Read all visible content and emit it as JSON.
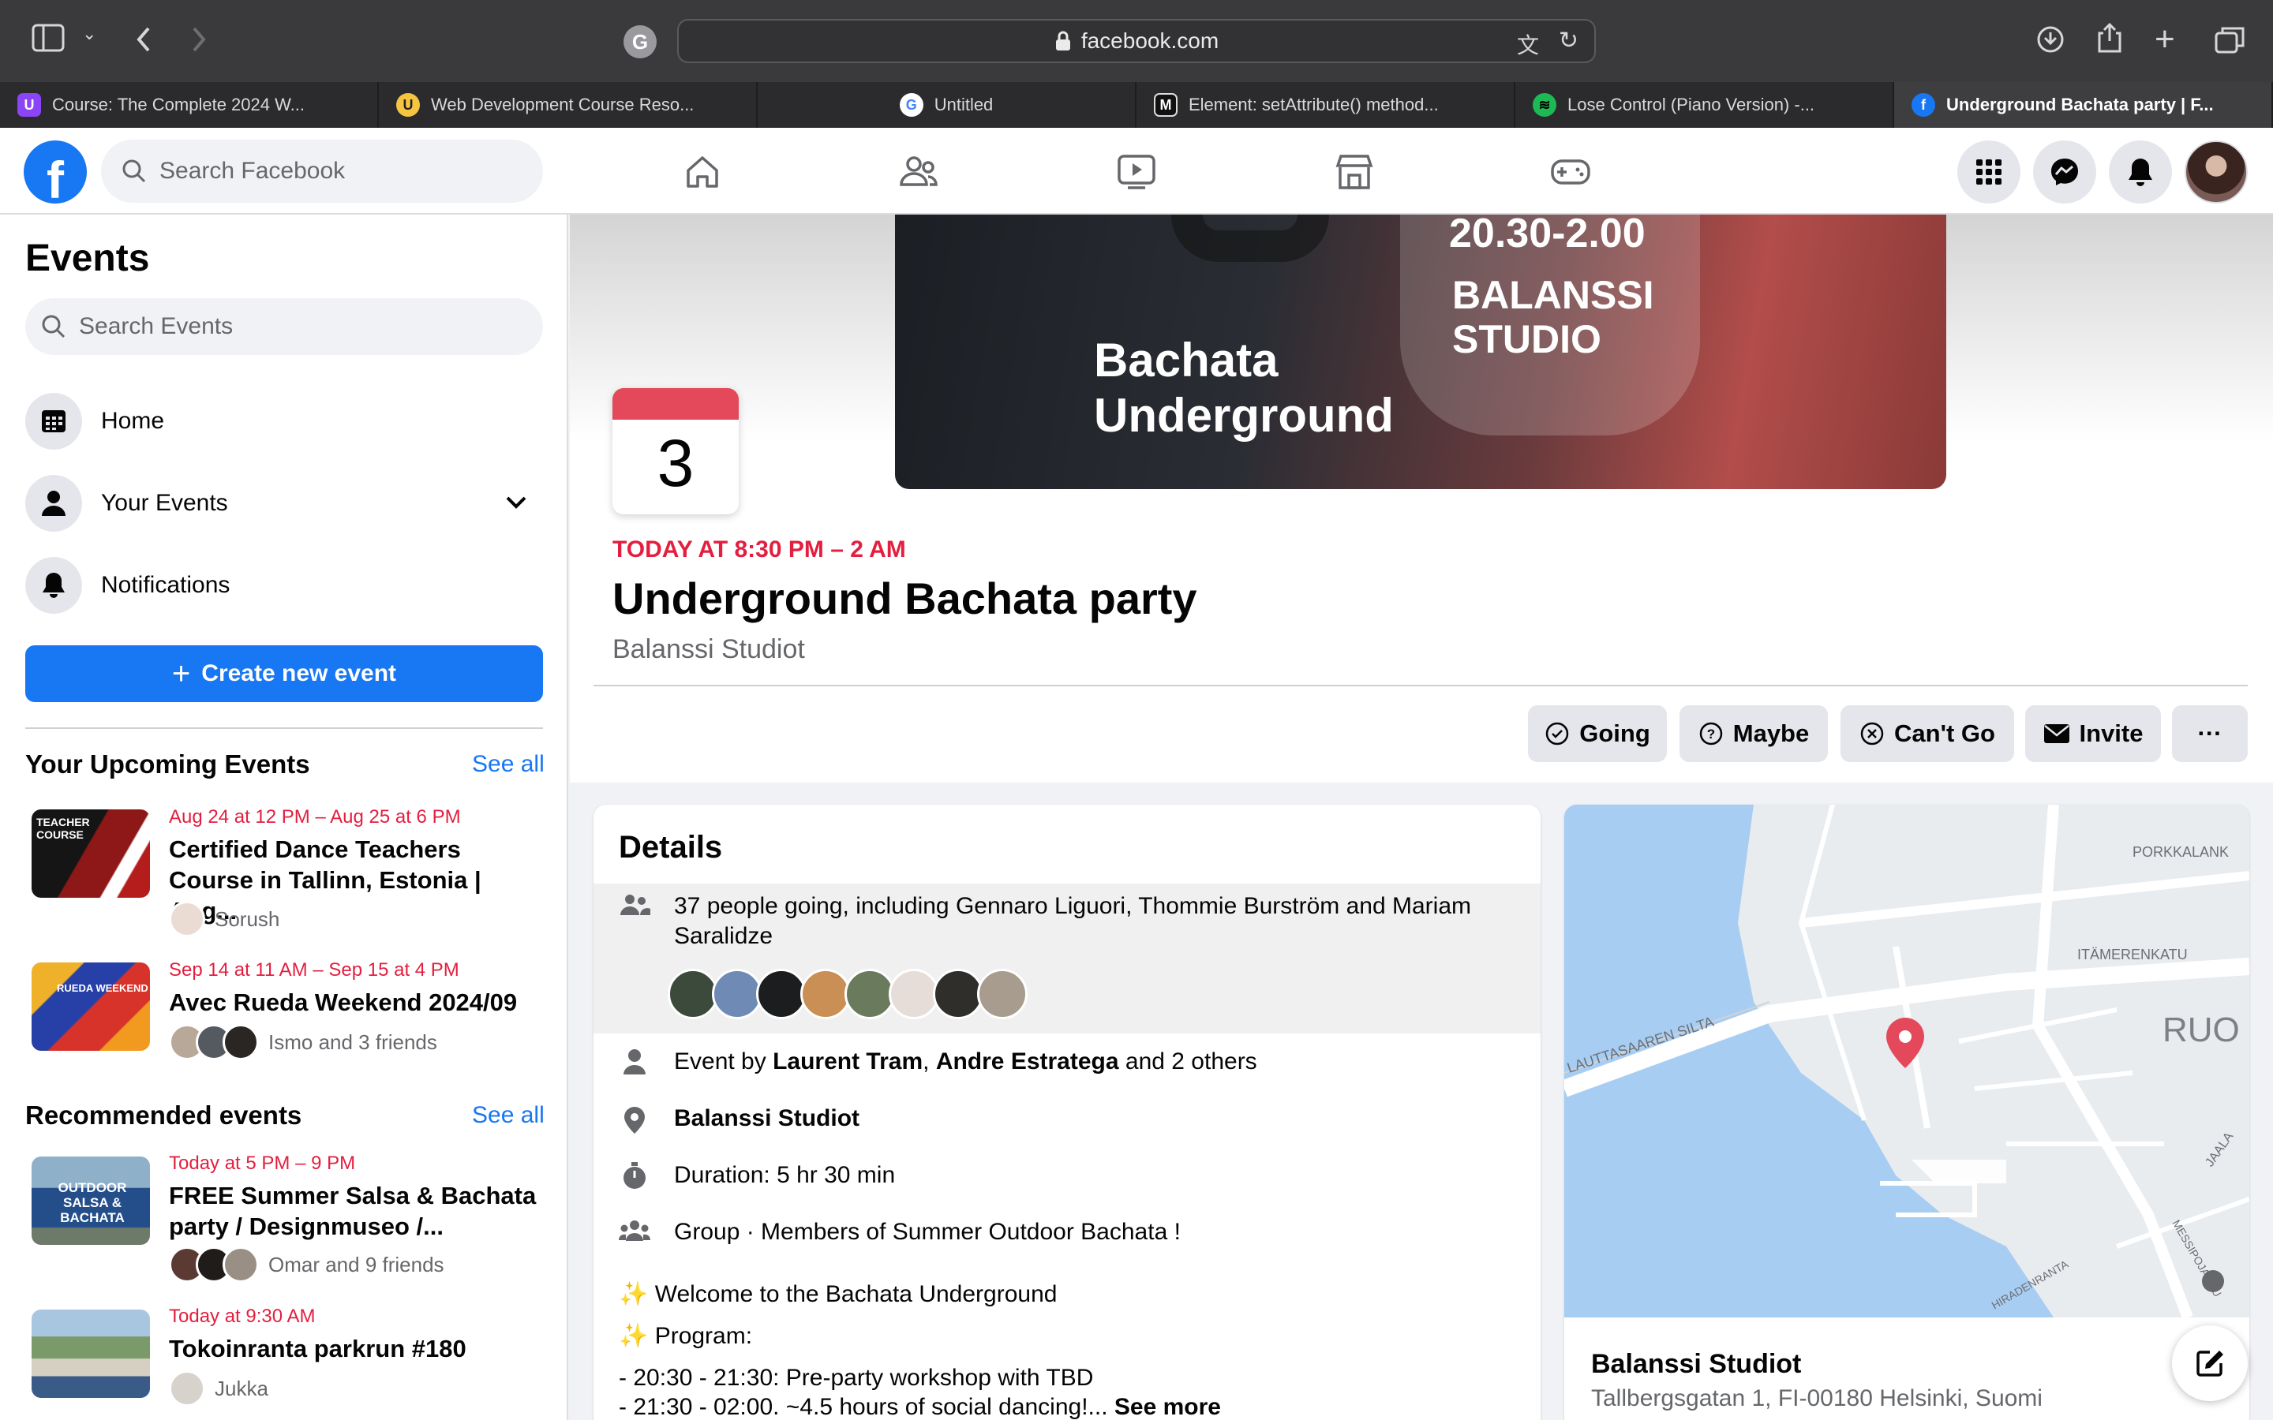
{
  "browser": {
    "url": "facebook.com",
    "tabs": [
      {
        "label": "Course: The Complete 2024 W...",
        "color": "#8c44f7",
        "glyph": "U"
      },
      {
        "label": "Web Development Course Reso...",
        "color": "#f5c542",
        "glyph": "U"
      },
      {
        "label": "Untitled",
        "color": "#ffffff",
        "glyph": "G"
      },
      {
        "label": "Element: setAttribute() method...",
        "color": "#111111",
        "glyph": "M"
      },
      {
        "label": "Lose Control (Piano Version) -...",
        "color": "#1db954",
        "glyph": "≋"
      },
      {
        "label": "Underground Bachata party | F...",
        "color": "#1877f2",
        "glyph": "f"
      }
    ]
  },
  "header": {
    "logo": "f",
    "search_placeholder": "Search Facebook"
  },
  "sidebar": {
    "title": "Events",
    "search_placeholder": "Search Events",
    "items": [
      {
        "label": "Home"
      },
      {
        "label": "Your Events"
      },
      {
        "label": "Notifications"
      }
    ],
    "create_label": "Create new event",
    "upcoming": {
      "title": "Your Upcoming Events",
      "see_all": "See all",
      "events": [
        {
          "date": "Aug 24 at 12 PM – Aug 25 at 6 PM",
          "title": "Certified Dance Teachers Course in Tallinn, Estonia | Aug...",
          "friends": "Sorush",
          "thumb_text": "TEACHER COURSE"
        },
        {
          "date": "Sep 14 at 11 AM – Sep 15 at 4 PM",
          "title": "Avec Rueda Weekend 2024/09",
          "friends": "Ismo and 3 friends",
          "thumb_text": "RUEDA WEEKEND"
        }
      ]
    },
    "recommended": {
      "title": "Recommended events",
      "see_all": "See all",
      "events": [
        {
          "date": "Today at 5 PM – 9 PM",
          "title": "FREE Summer Salsa & Bachata party / Designmuseo /...",
          "friends": "Omar and 9 friends",
          "thumb_text": "OUTDOOR SALSA & BACHATA"
        },
        {
          "date": "Today at 9:30 AM",
          "title": "Tokoinranta parkrun #180",
          "friends": "Jukka",
          "thumb_text": ""
        }
      ]
    }
  },
  "event": {
    "cover_time": "20.30-2.00",
    "cover_venue_1": "BALANSSI",
    "cover_venue_2": "STUDIO",
    "cover_title_1": "Bachata",
    "cover_title_2": "Underground",
    "day": "3",
    "when": "TODAY AT 8:30 PM – 2 AM",
    "name": "Underground Bachata party",
    "place": "Balanssi Studiot",
    "actions": {
      "going": "Going",
      "maybe": "Maybe",
      "cant_go": "Can't Go",
      "invite": "Invite",
      "more": "···"
    }
  },
  "details": {
    "title": "Details",
    "going_text": "37 people going, including Gennaro Liguori, Thommie Burström and Mariam Saralidze",
    "host_prefix": "Event by ",
    "host_1": "Laurent Tram",
    "host_sep": ", ",
    "host_2": "Andre Estratega",
    "host_suffix": " and 2 others",
    "location": "Balanssi Studiot",
    "duration": "Duration: 5 hr 30 min",
    "group": "Group · Members of Summer Outdoor Bachata !",
    "desc_1": "✨ Welcome to the Bachata Underground",
    "desc_2": "✨ Program:",
    "desc_3": "- 20:30 - 21:30: Pre-party workshop with TBD",
    "desc_4": "- 21:30 - 02:00. ~4.5 hours of social dancing!...",
    "see_more": "See more"
  },
  "map": {
    "labels": {
      "porkkalank": "PORKKALANK",
      "itamerenkatu": "ITÄMERENKATU",
      "silta": "LAUTTASAAREN SILTA",
      "ruo": "RUO",
      "jaala": "JAALA",
      "messipojan": "MESSIPOJANKU",
      "laadenranta": "HIRADENRANTA"
    },
    "place": "Balanssi Studiot",
    "address": "Tallbergsgatan 1, FI-00180 Helsinki, Suomi"
  },
  "colors": {
    "brand": "#1877f2",
    "date_red": "#e41e3f"
  }
}
